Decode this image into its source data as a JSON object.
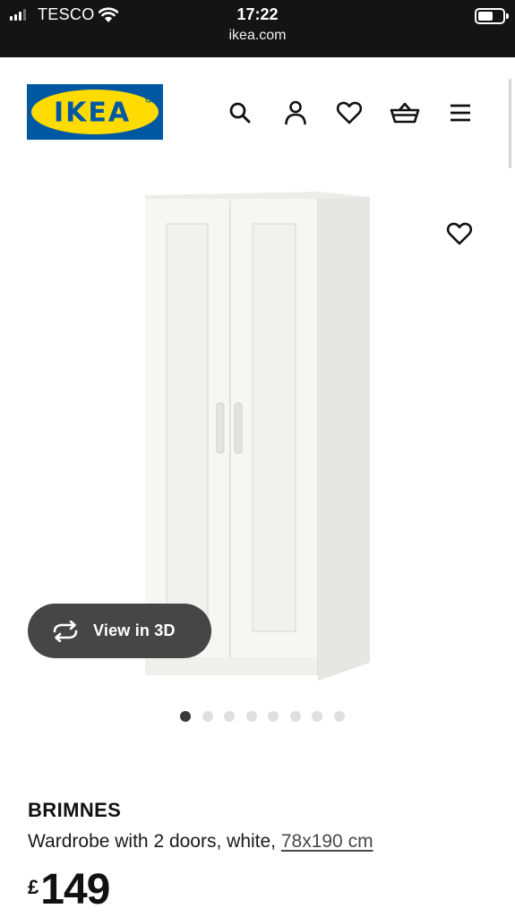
{
  "status_bar": {
    "carrier": "TESCO",
    "time": "17:22"
  },
  "browser": {
    "url": "ikea.com"
  },
  "header": {
    "logo_text": "IKEA",
    "brand_colors": {
      "blue": "#0058a3",
      "yellow": "#ffdb00"
    },
    "icons": [
      "search-icon",
      "account-icon",
      "wishlist-icon",
      "basket-icon",
      "menu-icon"
    ]
  },
  "gallery": {
    "view_3d_label": "View in 3D",
    "image_count": 8,
    "active_image": 1
  },
  "product": {
    "name": "BRIMNES",
    "description_prefix": "Wardrobe with 2 doors, white, ",
    "size": "78x190 cm",
    "currency": "£",
    "price": "149"
  }
}
